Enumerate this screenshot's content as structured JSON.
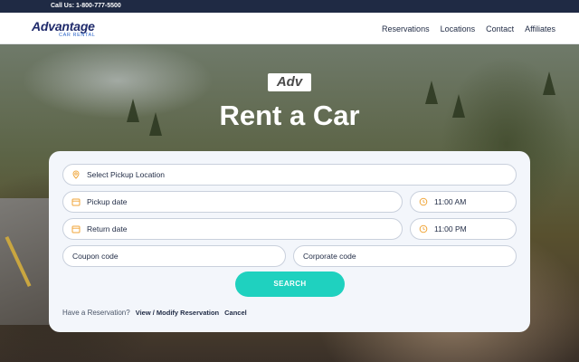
{
  "topbar": {
    "call_text": "Call Us: 1-800-777-5500"
  },
  "logo": {
    "word": "Advantage",
    "sub": "CAR RENTAL"
  },
  "nav": {
    "items": [
      "Reservations",
      "Locations",
      "Contact",
      "Affiliates"
    ]
  },
  "hero": {
    "emblem": "Adv",
    "title": "Rent a Car"
  },
  "form": {
    "pickup_location": "Select Pickup Location",
    "pickup_date": "Pickup date",
    "pickup_time": "11:00 AM",
    "return_date": "Return date",
    "return_time": "11:00 PM",
    "coupon": "Coupon code",
    "corporate": "Corporate code",
    "search_label": "SEARCH"
  },
  "reservation": {
    "label": "Have a Reservation?",
    "view_modify": "View / Modify Reservation",
    "cancel": "Cancel"
  },
  "colors": {
    "accent": "#1fd1bf",
    "icon": "#f0a63a",
    "topbar": "#1f2a44",
    "card": "#f3f6fb"
  },
  "icons": {
    "location": "map-pin-icon",
    "date": "calendar-icon",
    "time": "clock-icon"
  }
}
